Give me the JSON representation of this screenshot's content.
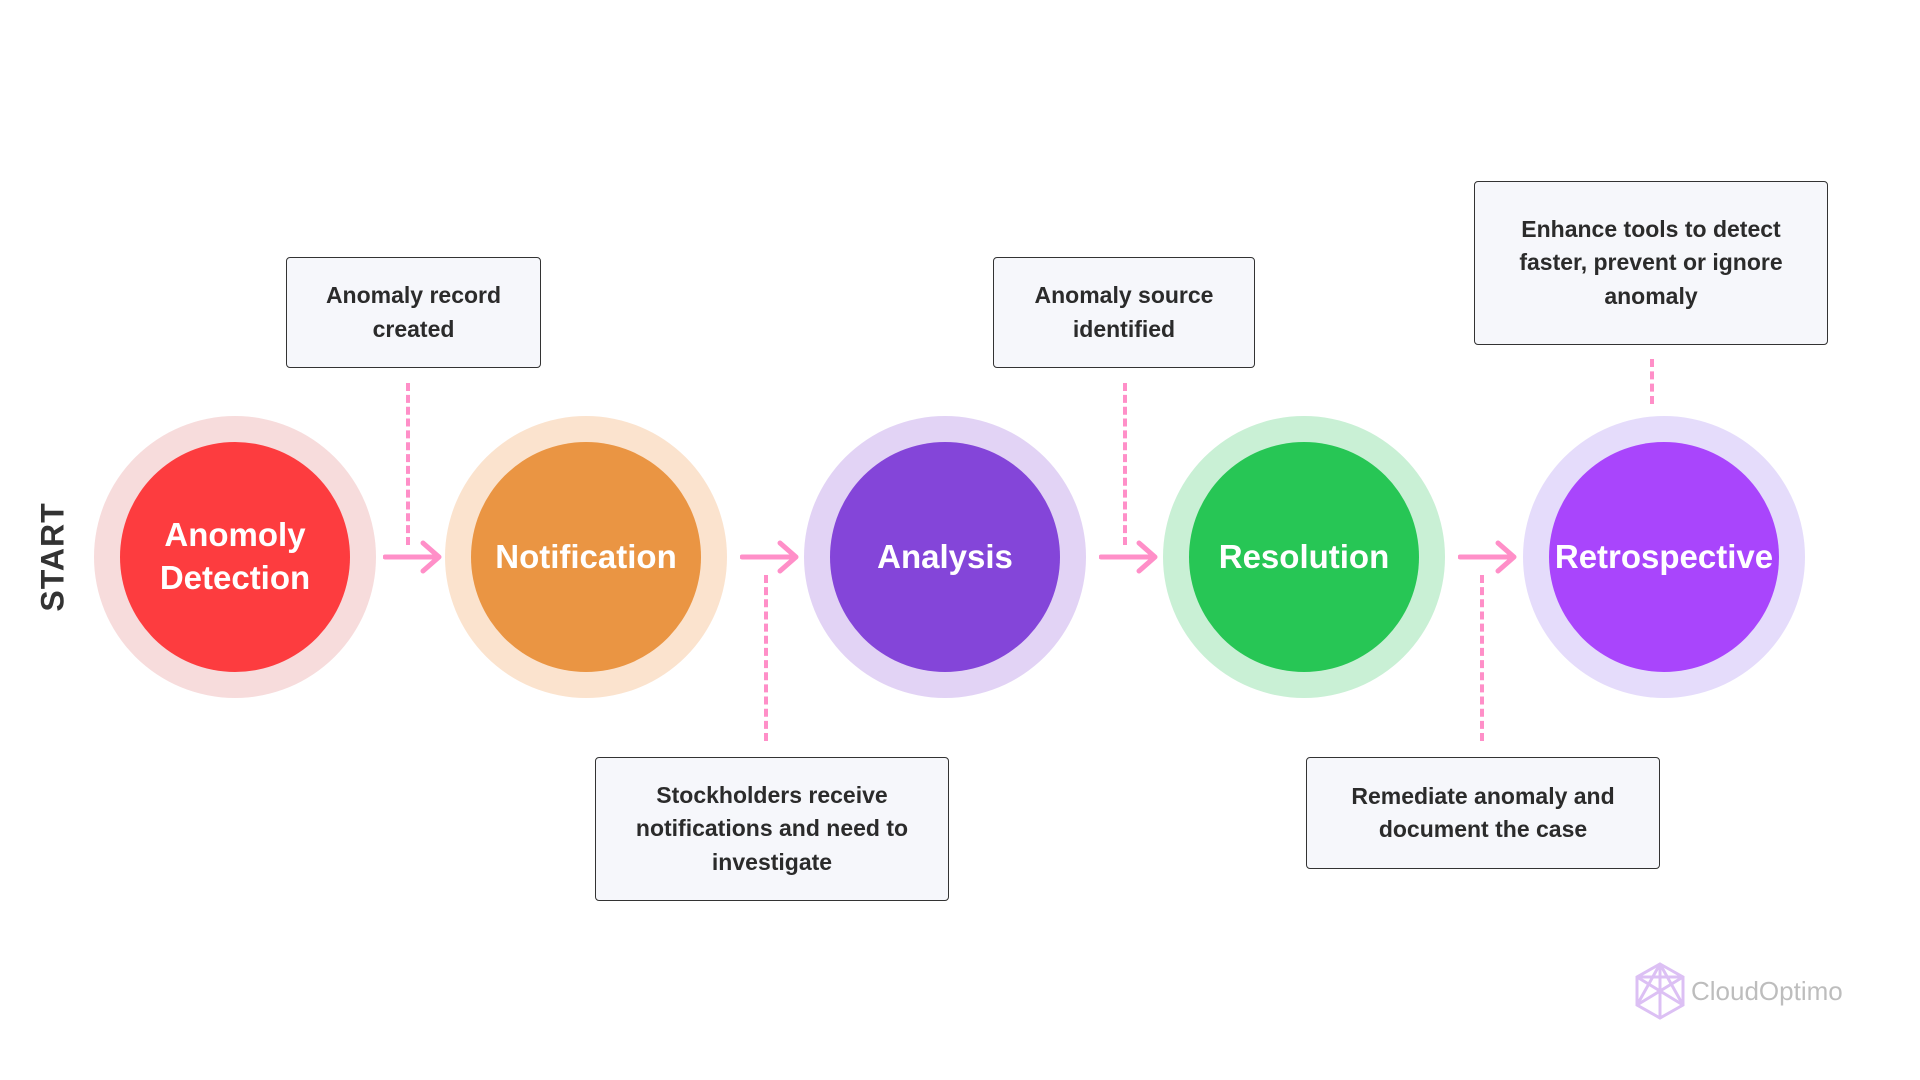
{
  "start_label": "START",
  "stages": [
    {
      "label": "Anomoly Detection",
      "color": "#fd3c3f",
      "ring_color": "#f7dcdc"
    },
    {
      "label": "Notification",
      "color": "#ea9543",
      "ring_color": "#fbe3ce"
    },
    {
      "label": "Analysis",
      "color": "#8445d9",
      "ring_color": "#e2d3f5"
    },
    {
      "label": "Resolution",
      "color": "#27c655",
      "ring_color": "#c9f0d5"
    },
    {
      "label": "Retrospective",
      "color": "#a945fc",
      "ring_color": "#e5dcfb"
    }
  ],
  "notes": [
    "Anomaly record created",
    "Stockholders receive notifications and need to investigate",
    "Anomaly source identified",
    "Remediate anomaly and document the case",
    "Enhance tools to detect faster, prevent or ignore anomaly"
  ],
  "connector_color": "#ff8fc8",
  "logo": {
    "text": "CloudOptimo",
    "icon": "hexagon-logo-icon"
  }
}
